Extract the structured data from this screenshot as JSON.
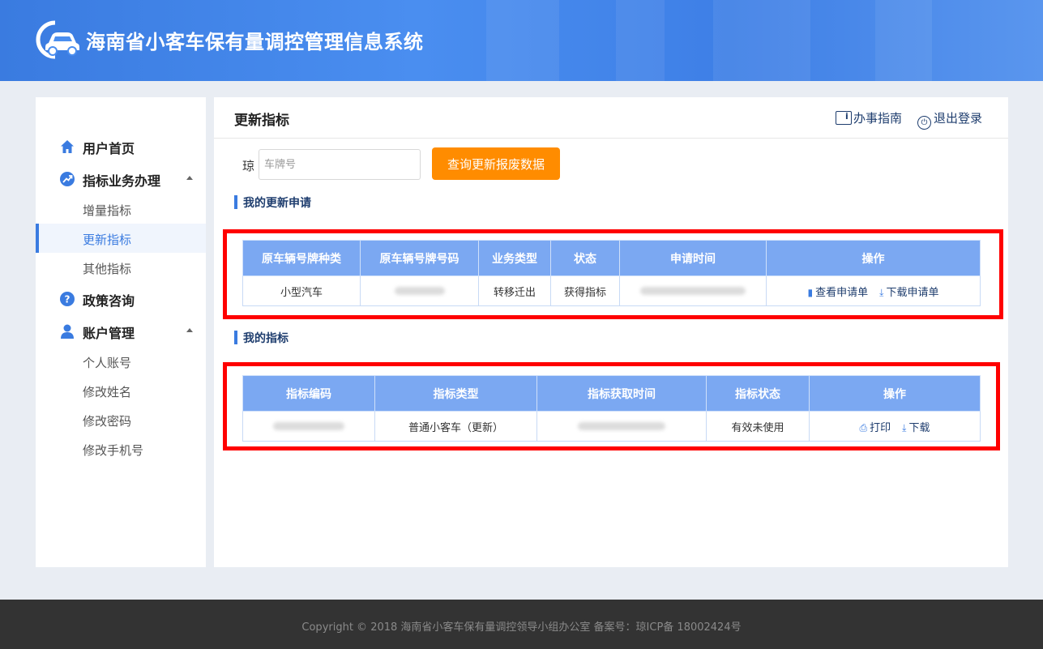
{
  "header": {
    "title": "海南省小客车保有量调控管理信息系统",
    "logo_icon": "car-logo-icon"
  },
  "sidebar": {
    "home": "用户首页",
    "quota_business": {
      "label": "指标业务办理",
      "items": [
        "增量指标",
        "更新指标",
        "其他指标"
      ]
    },
    "policy": "政策咨询",
    "account": {
      "label": "账户管理",
      "items": [
        "个人账号",
        "修改姓名",
        "修改密码",
        "修改手机号"
      ]
    },
    "active_item": "更新指标"
  },
  "main": {
    "title": "更新指标",
    "guide": "办事指南",
    "logout": "退出登录",
    "plate_prefix": "琼",
    "plate_placeholder": "车牌号",
    "plate_value": "",
    "query_button": "查询更新报废数据"
  },
  "applications": {
    "title": "我的更新申请",
    "columns": [
      "原车辆号牌种类",
      "原车辆号牌号码",
      "业务类型",
      "状态",
      "申请时间",
      "操作"
    ],
    "rows": [
      {
        "plate_type": "小型汽车",
        "business_type": "转移迁出",
        "status": "获得指标",
        "actions": [
          "查看申请单",
          "下载申请单"
        ]
      }
    ]
  },
  "quotas": {
    "title": "我的指标",
    "columns": [
      "指标编码",
      "指标类型",
      "指标获取时间",
      "指标状态",
      "操作"
    ],
    "rows": [
      {
        "quota_type": "普通小客车（更新）",
        "quota_status": "有效未使用",
        "actions": [
          "打印",
          "下载"
        ]
      }
    ]
  },
  "footer": {
    "text": "Copyright © 2018   海南省小客车保有量调控领导小组办公室    备案号：琼ICP备 18002424号"
  },
  "colors": {
    "header_blue": "#3a7be0",
    "table_header": "#7ba8f2",
    "accent_orange": "#ff8c00",
    "highlight_red": "#ff0000",
    "link_navy": "#1e3d6e"
  }
}
